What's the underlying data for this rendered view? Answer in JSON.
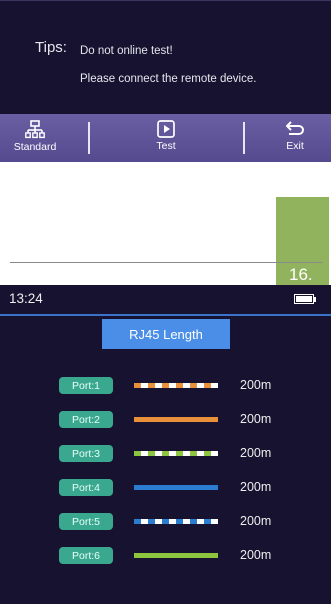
{
  "top_screen": {
    "tips_label": "Tips:",
    "tips_lines": [
      "Do not online test!",
      "Please connect the remote device."
    ],
    "buttons": [
      {
        "label": "Standard",
        "icon": "network-icon"
      },
      {
        "label": "Test",
        "icon": "play-icon"
      },
      {
        "label": "Exit",
        "icon": "return-icon"
      }
    ]
  },
  "page": {
    "number": "16."
  },
  "main_screen": {
    "status": {
      "time": "13:24",
      "battery": "battery-full-icon"
    },
    "title": "RJ45 Length",
    "ports": [
      {
        "label": "Port:1",
        "length": "200m",
        "color": "#e8913a",
        "striped": true
      },
      {
        "label": "Port:2",
        "length": "200m",
        "color": "#e8913a",
        "striped": false
      },
      {
        "label": "Port:3",
        "length": "200m",
        "color": "#8cc63f",
        "striped": true
      },
      {
        "label": "Port:4",
        "length": "200m",
        "color": "#2a7dd1",
        "striped": false
      },
      {
        "label": "Port:5",
        "length": "200m",
        "color": "#2a7dd1",
        "striped": true
      },
      {
        "label": "Port:6",
        "length": "200m",
        "color": "#8cc63f",
        "striped": false
      }
    ]
  },
  "colors": {
    "screen_bg": "#16122f",
    "button_bar": "#5d519a",
    "title_bg": "#4a8ee8",
    "port_tag": "#3aa78f",
    "page_badge": "#92b35e"
  }
}
